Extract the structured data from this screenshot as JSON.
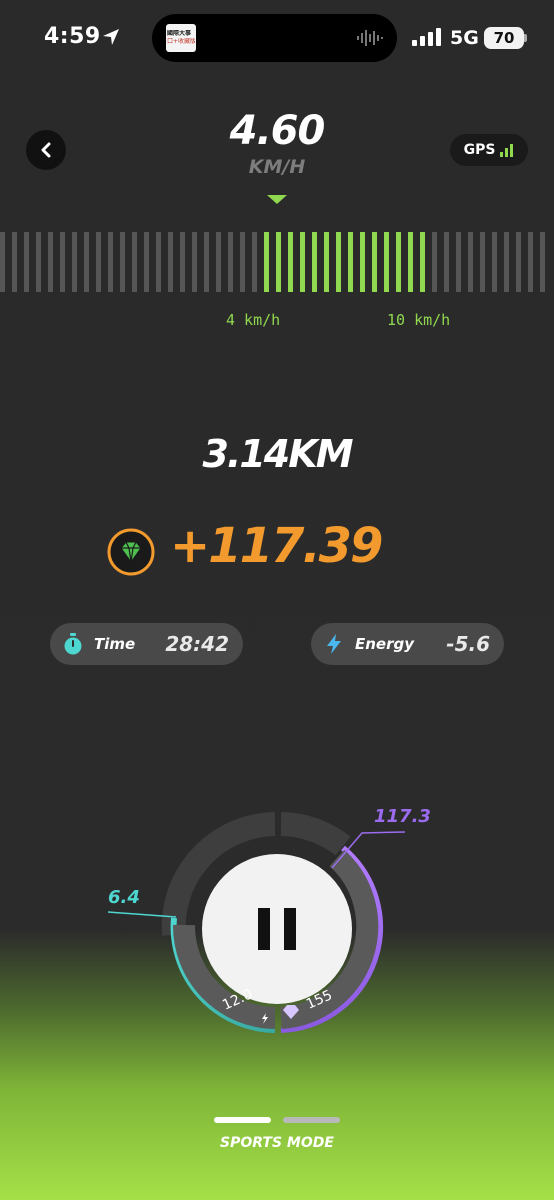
{
  "status_bar": {
    "time": "4:59",
    "network": "5G",
    "battery": "70",
    "island_title": "國際大事",
    "island_subtitle": "口+收藏版"
  },
  "header": {
    "speed": "4.60",
    "speed_unit": "KM/H",
    "gps_label": "GPS"
  },
  "speed_gauge": {
    "low_label": "4 km/h",
    "high_label": "10 km/h",
    "active_fraction_start": 0.47,
    "active_fraction_end": 0.78
  },
  "stats": {
    "distance": "3.14KM",
    "reward": "+117.39"
  },
  "chips": {
    "time_label": "Time",
    "time_value": "28:42",
    "energy_label": "Energy",
    "energy_value": "-5.6"
  },
  "ring": {
    "left_value": "6.4",
    "right_value": "117.3",
    "bottom_left_value": "12.0",
    "bottom_right_value": "155"
  },
  "footer": {
    "mode_label": "SPORTS MODE"
  },
  "colors": {
    "accent_green": "#8fd84f",
    "accent_orange": "#f29a2e",
    "accent_cyan": "#4ed7d0",
    "accent_purple": "#9b6cf0"
  },
  "icons": {
    "back": "chevron-left-icon",
    "gps": "signal-bars-icon",
    "reward": "gem-coin-icon",
    "time": "stopwatch-icon",
    "energy": "lightning-icon"
  }
}
